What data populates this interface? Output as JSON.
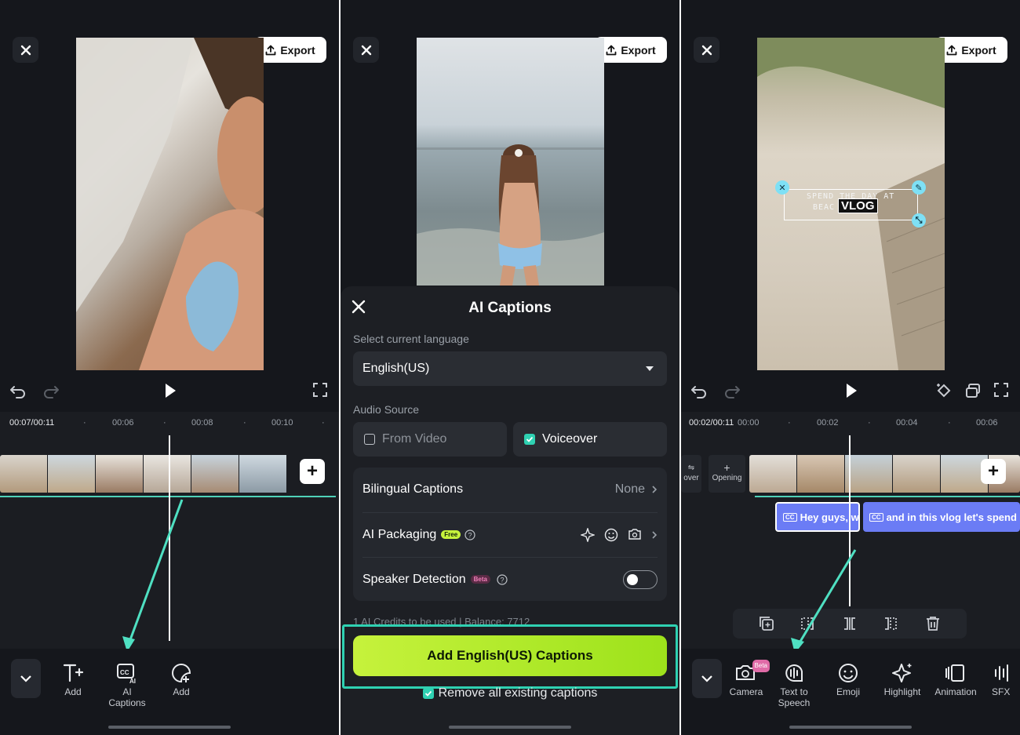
{
  "common": {
    "export_label": "Export"
  },
  "panel1": {
    "timecode": "00:07/00:11",
    "ruler_marks": [
      "00:06",
      "00:08",
      "00:10"
    ],
    "tools": [
      {
        "label": "Add",
        "icon": "text-add-icon"
      },
      {
        "label": "AI\nCaptions",
        "icon": "ai-captions-icon"
      },
      {
        "label": "Add",
        "icon": "sticker-add-icon"
      }
    ]
  },
  "panel2": {
    "sheet": {
      "title": "AI Captions",
      "select_language_label": "Select current language",
      "language_value": "English(US)",
      "audio_source_label": "Audio Source",
      "source_from_video": "From Video",
      "source_voiceover": "Voiceover",
      "bilingual_label": "Bilingual Captions",
      "bilingual_value": "None",
      "packaging_label": "AI Packaging",
      "packaging_badge": "Free",
      "speaker_label": "Speaker Detection",
      "speaker_badge": "Beta",
      "credits_text": "1 AI Credits to be used |  Balance: 7712",
      "cta_label": "Add English(US) Captions",
      "remove_label": "Remove all existing captions"
    }
  },
  "panel3": {
    "timecode": "00:02/00:11",
    "ruler_marks": [
      "00:00",
      "00:02",
      "00:04",
      "00:06"
    ],
    "side_tiles": [
      "over",
      "Opening"
    ],
    "sticker_text_1": "SPEND THE DAY AT",
    "sticker_text_2": "BEAC       ME",
    "sticker_vlog": "VLOG",
    "captions": [
      "Hey guys, w",
      "and in this vlog let's spend"
    ],
    "tools": [
      {
        "label": "Camera",
        "icon": "ai-camera-icon",
        "badge": "Beta"
      },
      {
        "label": "Text to\nSpeech",
        "icon": "text-to-speech-icon"
      },
      {
        "label": "Emoji",
        "icon": "emoji-icon"
      },
      {
        "label": "Highlight",
        "icon": "highlight-icon"
      },
      {
        "label": "Animation",
        "icon": "animation-icon"
      },
      {
        "label": "SFX",
        "icon": "sfx-icon"
      }
    ]
  },
  "colors": {
    "accent_teal": "#2fd1b2",
    "cta_lime": "#b8ee2e",
    "caption_blue": "#6b7cf5"
  }
}
